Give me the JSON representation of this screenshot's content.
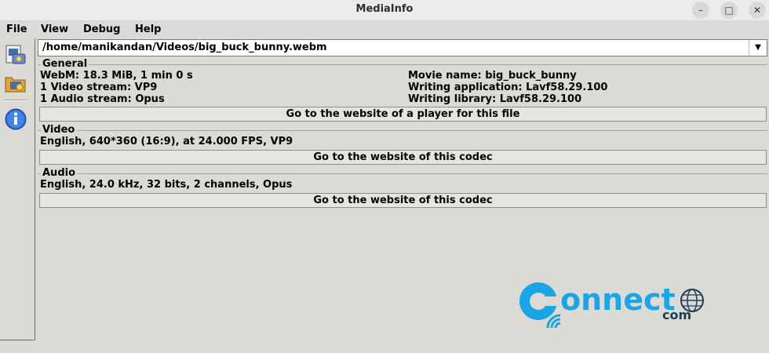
{
  "window": {
    "title": "MediaInfo"
  },
  "menu": [
    "File",
    "View",
    "Debug",
    "Help"
  ],
  "file_path": "/home/manikandan/Videos/big_buck_bunny.webm",
  "general": {
    "title": "General",
    "left": [
      "WebM: 18.3 MiB, 1 min 0 s",
      "1 Video stream: VP9",
      "1 Audio stream: Opus"
    ],
    "right": [
      "Movie name: big_buck_bunny",
      "Writing application: Lavf58.29.100",
      "Writing library: Lavf58.29.100"
    ],
    "button": "Go to the website of a player for this file"
  },
  "video": {
    "title": "Video",
    "line": "English, 640*360 (16:9), at 24.000 FPS, VP9",
    "button": "Go to the website of this codec"
  },
  "audio": {
    "title": "Audio",
    "line": "English, 24.0 kHz, 32 bits, 2 channels, Opus",
    "button": "Go to the website of this codec"
  },
  "watermark": {
    "main": "onnect",
    "sub": "com"
  },
  "icons": [
    "open-file-icon",
    "open-folder-icon",
    "info-icon",
    "minimize-icon",
    "maximize-icon",
    "close-icon",
    "dropdown-arrow-icon"
  ],
  "colors": {
    "background": "#dcdad5",
    "accent": "#1aa6e6"
  }
}
